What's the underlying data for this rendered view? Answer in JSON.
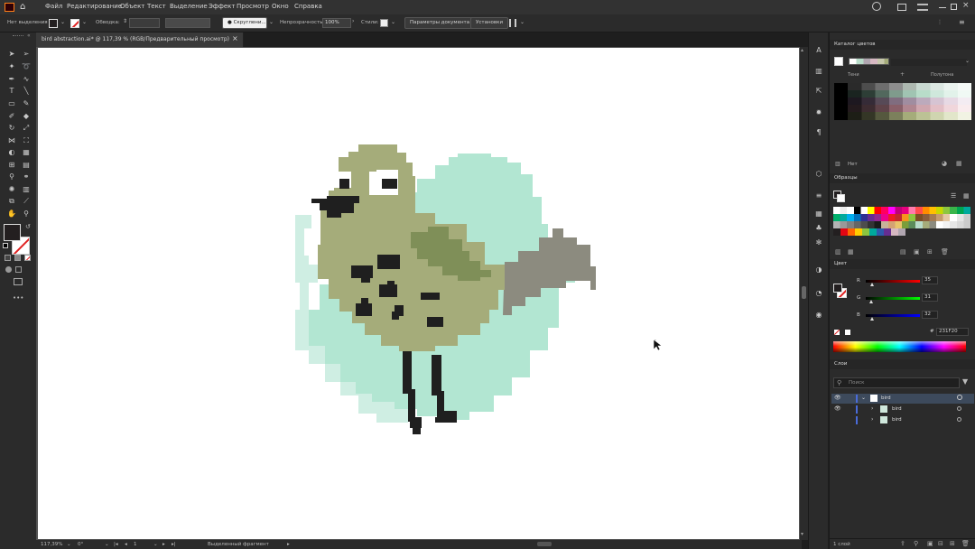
{
  "menu": {
    "items": [
      "Файл",
      "Редактирование",
      "Объект",
      "Текст",
      "Выделение",
      "Эффект",
      "Просмотр",
      "Окно",
      "Справка"
    ]
  },
  "control_bar": {
    "selection_status": "Нет выделения",
    "stroke_label": "Обводка:",
    "brush_label": "Скруглени...",
    "opacity_label": "Непрозрачность:",
    "opacity_value": "100%",
    "styles_label": "Стили:",
    "doc_params_button": "Параметры документа",
    "settings_button": "Установки"
  },
  "document": {
    "tab_title": "bird abstraction.ai* @ 117,39 % (RGB/Предварительный просмотр)",
    "close_icon": "×"
  },
  "status": {
    "zoom": "117,39%",
    "rotation": "0°",
    "artboard_num": "1",
    "tool_status": "Выделенный фрагмент"
  },
  "color_catalog": {
    "title": "Каталог цветов",
    "col_shades": "Тени",
    "col_halftones": "Полутона",
    "none_label": "Нет"
  },
  "swatches": {
    "title": "Образцы"
  },
  "color_panel": {
    "title": "Цвет",
    "r_label": "R",
    "r_value": "35",
    "g_label": "G",
    "g_value": "31",
    "b_label": "B",
    "b_value": "32",
    "hex_label": "#",
    "hex_value": "231F20"
  },
  "layers_panel": {
    "title": "Слои",
    "search_placeholder": "Поиск",
    "layers": [
      {
        "name": "bird",
        "level": 0
      },
      {
        "name": "bird",
        "level": 1
      },
      {
        "name": "bird",
        "level": 1
      }
    ],
    "footer": "1 слой"
  },
  "colors": {
    "bird_body": "#a5ac7a",
    "bird_wing": "#7f8f58",
    "bird_tail": "#8c8b7f",
    "bird_dark": "#1f1f1f",
    "bg_blob": "#b2e6d2",
    "bg_blob_light": "#cfeee3",
    "ui_bg": "#2b2b2b",
    "accent": "#4a90d9"
  }
}
